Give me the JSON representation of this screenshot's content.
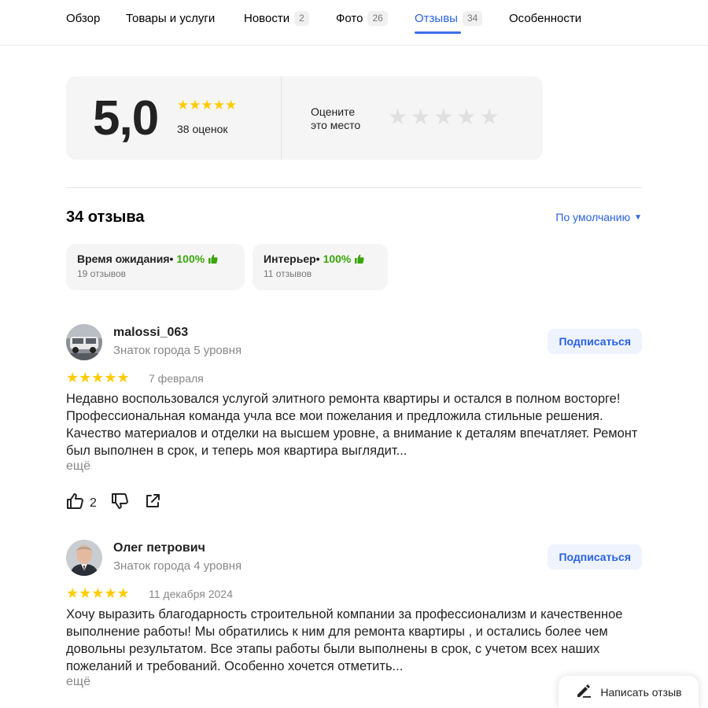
{
  "tabs": [
    {
      "label": "Обзор",
      "count": null
    },
    {
      "label": "Товары и услуги",
      "count": null
    },
    {
      "label": "Новости",
      "count": "2"
    },
    {
      "label": "Фото",
      "count": "26"
    },
    {
      "label": "Отзывы",
      "count": "34"
    },
    {
      "label": "Особенности",
      "count": null
    }
  ],
  "active_tab": "Отзывы",
  "rating": {
    "value": "5,0",
    "stars": "★★★★★",
    "stars_value": 5,
    "count_label": "38 оценок",
    "rate_prompt_line1": "Оцените",
    "rate_prompt_line2": "это место",
    "rate_star_glyph": "★"
  },
  "reviews_header": {
    "count_label": "34 отзыва",
    "sort_label": "По умолчанию",
    "sort_arrow": "▼"
  },
  "aspects": [
    {
      "name": "Время ожидания",
      "bullet": " •",
      "percent": "100%",
      "sub": "19 отзывов"
    },
    {
      "name": "Интерьер",
      "bullet": " •",
      "percent": "100%",
      "sub": "11 отзывов"
    }
  ],
  "reviews": [
    {
      "author": "malossi_063",
      "level": "Знаток города 5 уровня",
      "subscribe_label": "Подписаться",
      "stars": "★★★★★",
      "stars_value": 5,
      "date": "7 февраля",
      "text": "Недавно воспользовался услугой элитного ремонта квартиры и остался в полном восторге! Профессиональная команда учла все мои пожелания и предложила стильные решения. Качество материалов и отделки на высшем уровне, а внимание к деталям впечатляет. Ремонт был выполнен в срок, и теперь моя квартира выглядит...",
      "more_label": "ещё",
      "likes": "2"
    },
    {
      "author": "Олег петрович",
      "level": "Знаток города 4 уровня",
      "subscribe_label": "Подписаться",
      "stars": "★★★★★",
      "stars_value": 5,
      "date": "11 декабря 2024",
      "text": "Хочу выразить благодарность строительной компании за профессионализм и качественное выполнение работы! Мы обратились к ним для ремонта квартиры , и остались более чем довольны результатом. Все этапы работы были выполнены в срок, с учетом всех наших пожеланий и требований. Особенно хочется отметить...",
      "more_label": "ещё"
    }
  ],
  "write_review_label": "Написать отзыв",
  "colors": {
    "accent": "#2a62df",
    "star": "#ffcc00",
    "positive": "#3aa60c"
  }
}
